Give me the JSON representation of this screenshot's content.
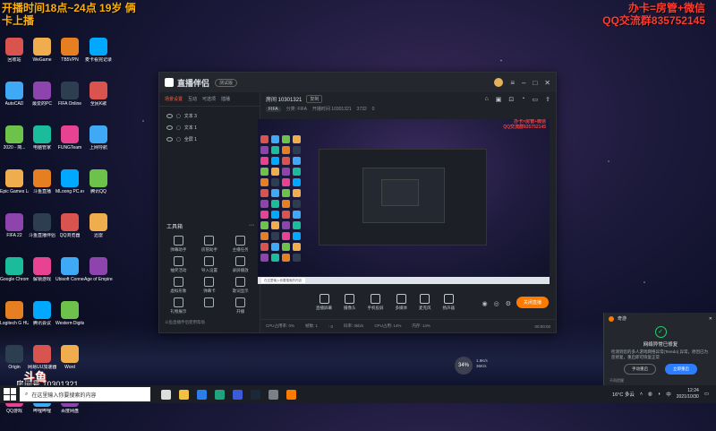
{
  "overlay": {
    "top_left": "开播时间18点~24点 19岁 俩卡上播",
    "top_right_line1": "办卡=房管+微信",
    "top_right_line2": "QQ交流群835752145"
  },
  "desktop": {
    "col1": [
      "回收站",
      "AutoCAD",
      "2020 - 简...",
      "Epic Games Launcher",
      "FIFA 22",
      "Google Chrome",
      "Logitech G HUB",
      "Origin",
      "QQ游戏"
    ],
    "col2": [
      "WeGame",
      "最爱的PC",
      "电脑管家",
      "斗鱼直播",
      "斗鱼直播伴侣",
      "解锁游戏",
      "腾讯会议",
      "网易UU加速器",
      "哔哩哔哩"
    ],
    "col3": [
      "TB5VPN",
      "FIFA Online",
      "FUNGTeam",
      "MLoong PC.exe",
      "QQ浏览器",
      "Ubisoft Connect",
      "Western Digital SS...",
      "Word",
      "百度网盘"
    ],
    "col4": [
      "麦卡看完记录",
      "全民K歌",
      "上网导航",
      "腾讯QQ",
      "迅雷",
      "Age of Empires IV"
    ]
  },
  "window": {
    "app_name": "直播伴侣",
    "version_pill": "测试版",
    "tabs": [
      "场景设置",
      "互动",
      "可选项",
      "插播"
    ],
    "scenes": [
      "文本 3",
      "文本 1",
      "全屏 1"
    ],
    "tools_label": "工具箱",
    "tools": [
      "弹幕助手",
      "房管助手",
      "主播任务",
      "抽奖活动",
      "导入设置",
      "录屏播放",
      "虚拟形象",
      "弹幕卡",
      "歌词显示",
      "礼物展示",
      "",
      "开播"
    ],
    "bottom_note": "斗鱼直播伴侣使用帮助",
    "room_label": "房间 10301321",
    "copy_label": "复制",
    "category_tag": "FIFA",
    "sub_info": [
      "分类: FIFA",
      "开播时间 10301321",
      "3732",
      "0"
    ],
    "preview_overlay_1": "办卡=房管+微信",
    "preview_overlay_2": "QQ交流群835752145",
    "preview_search": "在这里输入你要搜索的内容",
    "controls": [
      "直播屏幕",
      "摄像头",
      "手机投屏",
      "多媒体",
      "麦克风",
      "扬声器"
    ],
    "go_live": "关闭直播",
    "status": [
      "CPU占用率: 0%",
      "帧数: 1",
      ": 0",
      "码率: 0kb/s",
      "CPU占用: 14%",
      "内存: 14%"
    ],
    "status_time": "00:00:00"
  },
  "notification": {
    "app": "奇游",
    "title": "网络异常已修复",
    "text": "检测到您的多人游戏网络异常(Teredo) 异常，原因已为您修复，重启即可恢复正常",
    "btn_secondary": "手动重启",
    "btn_primary": "立即重启",
    "footer": "不再提醒"
  },
  "fps_widget": {
    "value": "34%",
    "meta1": "1.9K/s",
    "meta2": "36K/s"
  },
  "streamer": {
    "logo": "斗鱼",
    "room": "房间号 10301321"
  },
  "taskbar": {
    "search_placeholder": "在这里输入你要搜索的内容",
    "weather": "16°C 多云",
    "lang": "中",
    "time": "12:24",
    "date": "2021/10/30"
  },
  "colors": {
    "accent": "#ff7a00",
    "overlay_yellow": "#ffb000",
    "overlay_red": "#ff3b30"
  }
}
